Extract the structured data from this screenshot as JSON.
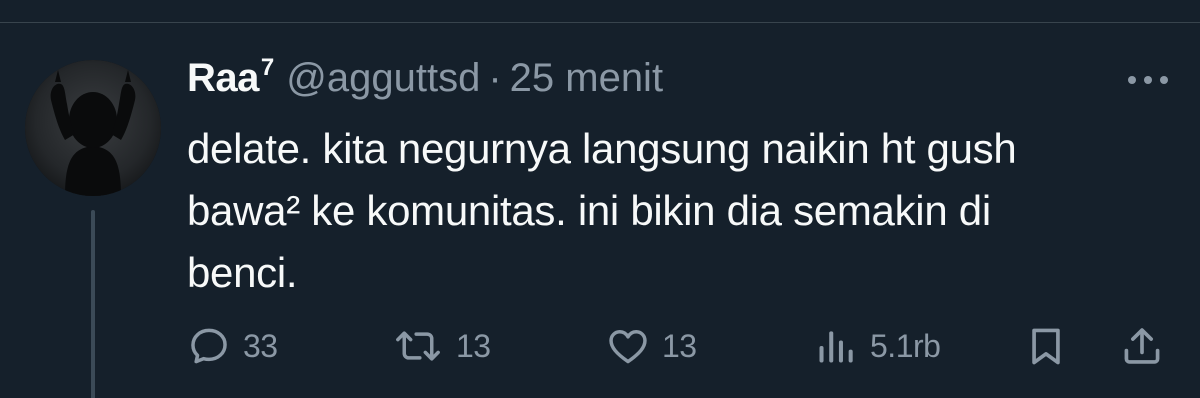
{
  "tweet": {
    "display_name": "Raa",
    "display_name_sup": "7",
    "handle": "@agguttsd",
    "separator": "·",
    "time": "25 menit",
    "text_lines": [
      "delate. kita negurnya langsung naikin ht gush",
      "bawa² ke komunitas. ini bikin dia semakin di",
      "benci."
    ]
  },
  "actions": {
    "reply_count": "33",
    "retweet_count": "13",
    "like_count": "13",
    "views_count": "5.1rb"
  },
  "icons": {
    "more": "more-horizontal-icon",
    "reply": "reply-bubble-icon",
    "retweet": "retweet-icon",
    "like": "heart-icon",
    "views": "views-bar-chart-icon",
    "bookmark": "bookmark-icon",
    "share": "share-upload-icon"
  },
  "colors": {
    "background": "#15202b",
    "text_primary": "#f7f9f9",
    "text_secondary": "#8b98a5",
    "divider": "#38444d"
  }
}
